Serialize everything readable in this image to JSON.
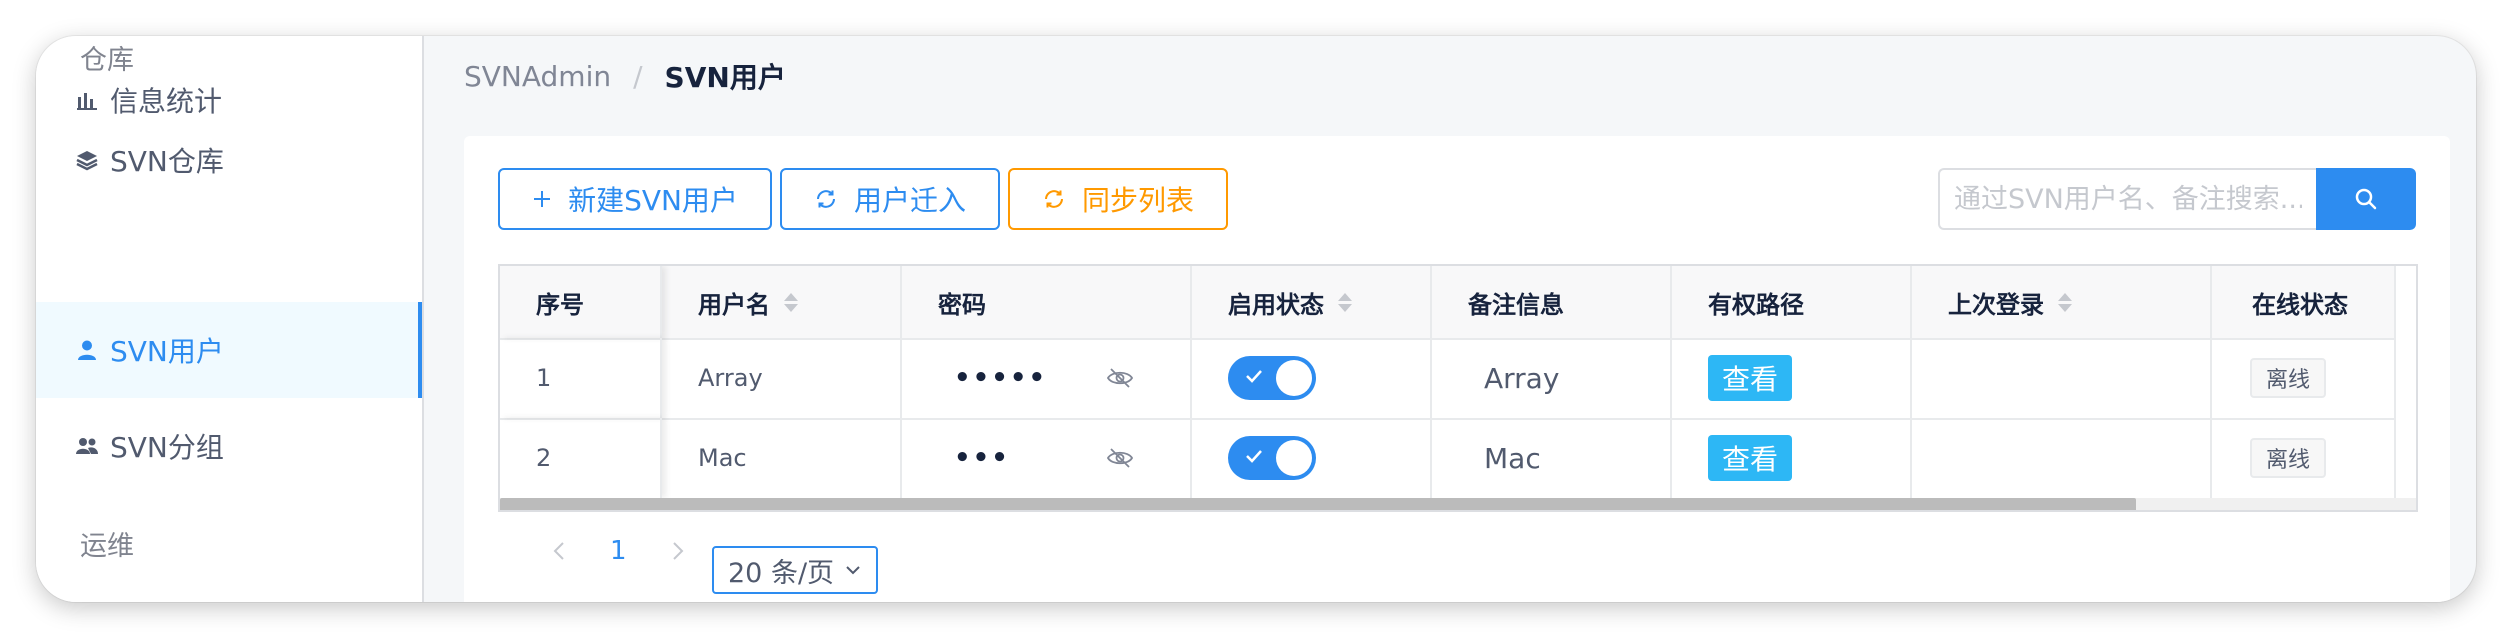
{
  "sidebar": {
    "group_repo": "仓库",
    "group_ops": "运维",
    "items": [
      {
        "label": "信息统计",
        "icon": "bar-chart-icon"
      },
      {
        "label": "SVN仓库",
        "icon": "stack-icon"
      },
      {
        "label": "SVN用户",
        "icon": "user-icon",
        "active": true
      },
      {
        "label": "SVN分组",
        "icon": "group-icon"
      }
    ]
  },
  "breadcrumb": {
    "home": "SVNAdmin",
    "separator": "/",
    "current": "SVN用户"
  },
  "toolbar": {
    "new_user": "新建SVN用户",
    "migrate": "用户迁入",
    "sync": "同步列表",
    "search_placeholder": "通过SVN用户名、备注搜索..."
  },
  "table": {
    "headers": [
      "序号",
      "用户名",
      "密码",
      "启用状态",
      "备注信息",
      "有权路径",
      "上次登录",
      "在线状态"
    ],
    "rows": [
      {
        "index": "1",
        "username": "Array",
        "password": "•••••",
        "enabled": true,
        "note": "Array",
        "path_btn": "查看",
        "last_login": "",
        "status": "离线"
      },
      {
        "index": "2",
        "username": "Mac",
        "password": "•••",
        "enabled": true,
        "note": "Mac",
        "path_btn": "查看",
        "last_login": "",
        "status": "离线"
      }
    ]
  },
  "pagination": {
    "current": "1",
    "page_size": "20 条/页"
  },
  "colors": {
    "primary": "#2d8cf0",
    "warning": "#ff9900",
    "info": "#2db7f5"
  }
}
